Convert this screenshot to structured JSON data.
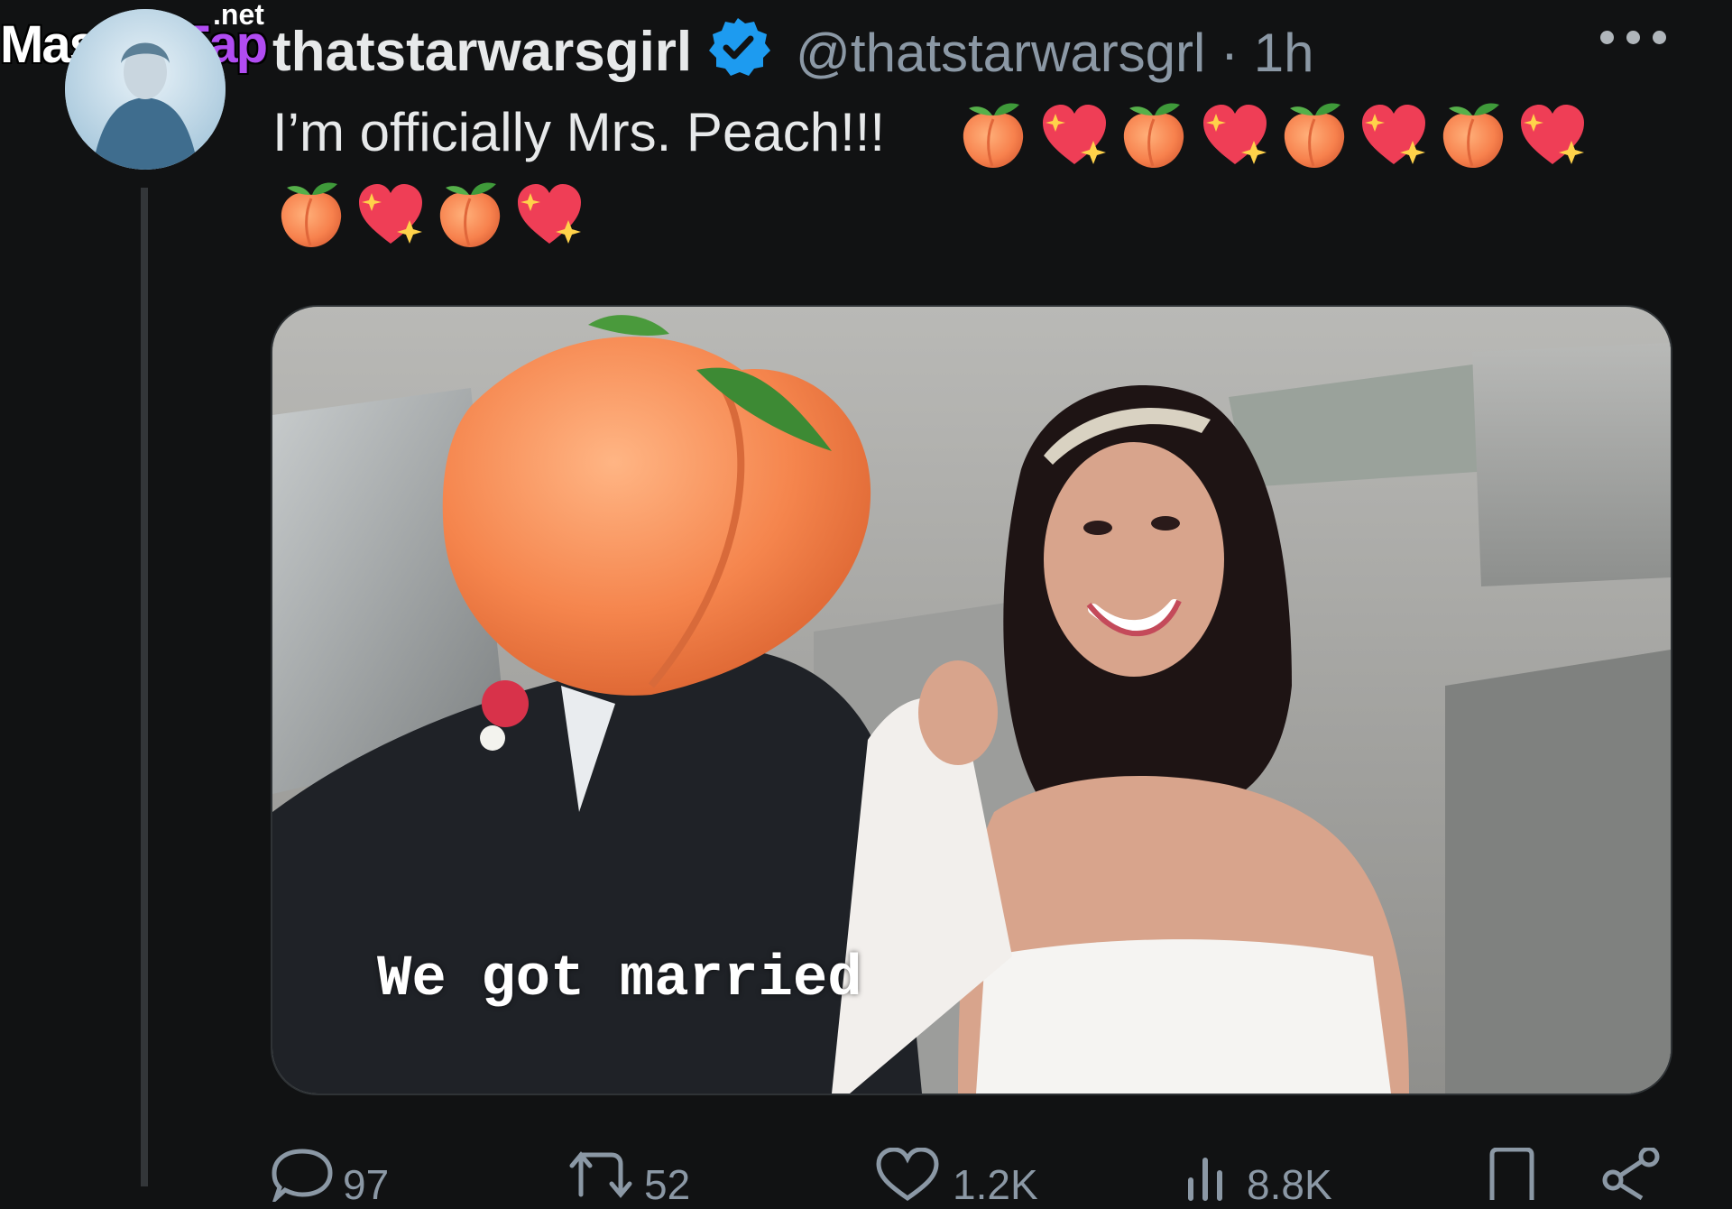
{
  "watermark": {
    "main": "Master",
    "accent": "Fap",
    "suffix": ".net"
  },
  "tweet": {
    "display_name": "thatstarwarsgirl",
    "handle": "@thatstarwarsgrl",
    "separator": "·",
    "time": "1h",
    "text": "I’m officially Mrs. Peach!!!",
    "emoji_sequence": [
      "peach",
      "sparkling-heart",
      "peach",
      "sparkling-heart",
      "peach",
      "sparkling-heart",
      "peach",
      "sparkling-heart",
      "peach",
      "sparkling-heart",
      "peach",
      "sparkling-heart"
    ],
    "media_caption": "We got married"
  },
  "actions": {
    "reply_count": "97",
    "retweet_count": "52",
    "like_count": "1.2K",
    "views_count": "8.8K"
  },
  "colors": {
    "background": "#111213",
    "text": "#e7e9ea",
    "secondary_text": "#8b98a5",
    "verified_badge": "#1d9bf0",
    "watermark_accent": "#b14cf2"
  }
}
